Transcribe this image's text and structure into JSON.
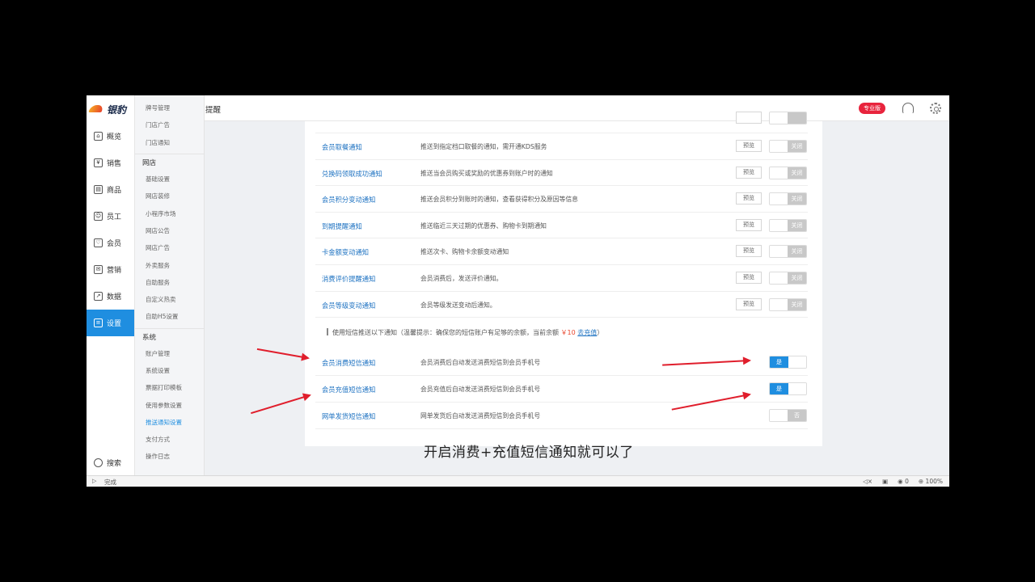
{
  "app": {
    "logo_text": "银豹"
  },
  "nav": [
    {
      "label": "概览",
      "icon": "home-icon",
      "glyph": "⌂"
    },
    {
      "label": "销售",
      "icon": "sales-icon",
      "glyph": "¥"
    },
    {
      "label": "商品",
      "icon": "goods-icon",
      "glyph": "▤"
    },
    {
      "label": "员工",
      "icon": "staff-icon",
      "glyph": "☺"
    },
    {
      "label": "会员",
      "icon": "member-icon",
      "glyph": "♡"
    },
    {
      "label": "营销",
      "icon": "marketing-icon",
      "glyph": "✉"
    },
    {
      "label": "数据",
      "icon": "chart-icon",
      "glyph": "↗"
    },
    {
      "label": "设置",
      "icon": "settings-menu-icon",
      "glyph": "≡",
      "active": true
    }
  ],
  "nav_search": "搜索",
  "submenu": {
    "top_items": [
      "牌号管理",
      "门店广告",
      "门店通知"
    ],
    "group_online": "网店",
    "online_items": [
      "基础设置",
      "网店装修",
      "小程序市场",
      "网店公告",
      "网店广告",
      "外卖服务",
      "自助服务",
      "自定义热卖",
      "自助H5设置"
    ],
    "group_system": "系统",
    "system_items": [
      "账户管理",
      "系统设置",
      "票据打印模板",
      "使用参数设置",
      "推送通知设置",
      "支付方式",
      "操作日志"
    ],
    "active": "推送通知设置"
  },
  "header": {
    "title": "提醒",
    "badge": "专业版"
  },
  "rows": [
    {
      "title": "会员取餐通知",
      "desc": "推送到指定档口取餐的通知，需开通KDS服务",
      "preview": "预览",
      "toggle": "关闭",
      "on": false
    },
    {
      "title": "兑换码领取成功通知",
      "desc": "推送当会员购买或奖励的优惠券到账户时的通知",
      "preview": "预览",
      "toggle": "关闭",
      "on": false
    },
    {
      "title": "会员积分变动通知",
      "desc": "推送会员积分到账时的通知，查看获得积分及原因等信息",
      "preview": "预览",
      "toggle": "关闭",
      "on": false
    },
    {
      "title": "到期提醒通知",
      "desc": "推送临近三天过期的优惠券、购物卡到期通知",
      "preview": "预览",
      "toggle": "关闭",
      "on": false
    },
    {
      "title": "卡金额变动通知",
      "desc": "推送次卡、购物卡余额变动通知",
      "preview": "预览",
      "toggle": "关闭",
      "on": false
    },
    {
      "title": "消费评价提醒通知",
      "desc": "会员消费后，发送评价通知。",
      "preview": "预览",
      "toggle": "关闭",
      "on": false
    },
    {
      "title": "会员等级变动通知",
      "desc": "会员等级发送变动后通知。",
      "preview": "预览",
      "toggle": "关闭",
      "on": false
    }
  ],
  "sms_header": {
    "prefix": "使用短信推送以下通知（温馨提示：确保您的短信账户有足够的余额，当前余额",
    "amount": "￥10",
    "link": "去充值",
    "suffix": "）"
  },
  "sms_rows": [
    {
      "title": "会员消费短信通知",
      "desc": "会员消费后自动发送消费短信到会员手机号",
      "toggle": "是",
      "on": true
    },
    {
      "title": "会员充值短信通知",
      "desc": "会员充值后自动发送消费短信到会员手机号",
      "toggle": "是",
      "on": true
    },
    {
      "title": "网单发货短信通知",
      "desc": "网单发货后自动发送消费短信到会员手机号",
      "toggle": "否",
      "on": false
    }
  ],
  "caption": "开启消费+充值短信通知就可以了",
  "status": {
    "text": "完成",
    "count": "0",
    "zoom": "100%"
  }
}
